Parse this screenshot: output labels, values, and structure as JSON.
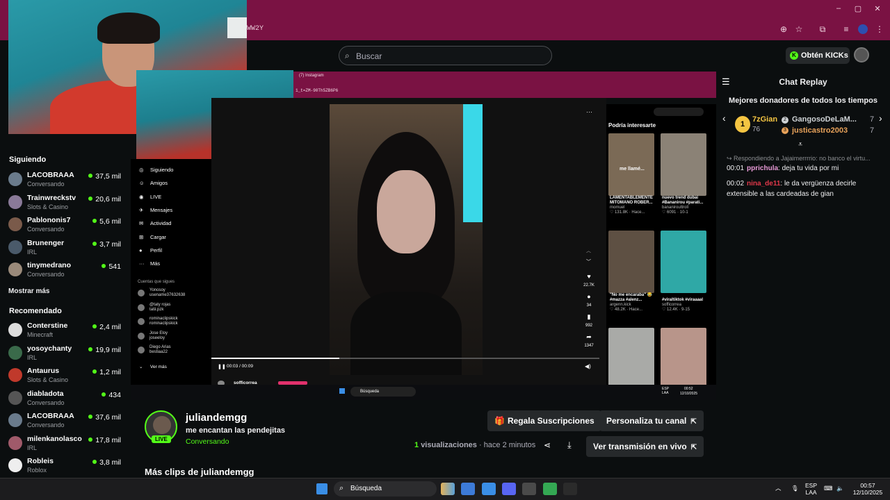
{
  "browser": {
    "url_fragment": "WW2Y",
    "window_controls": [
      "–",
      "▢",
      "✕"
    ]
  },
  "header": {
    "search_placeholder": "Buscar",
    "kicks_button": "Obtén KICKs"
  },
  "sidebar": {
    "following_title": "Siguiendo",
    "following": [
      {
        "name": "LACOBRAAA",
        "category": "Conversando",
        "viewers": "37,5 mil",
        "color": "#6a7b8c"
      },
      {
        "name": "Trainwreckstv",
        "category": "Slots & Casino",
        "viewers": "20,6 mil",
        "color": "#8a7a99"
      },
      {
        "name": "Pablononis7",
        "category": "Conversando",
        "viewers": "5,6 mil",
        "color": "#7a5a4a"
      },
      {
        "name": "Brunenger",
        "category": "IRL",
        "viewers": "3,7 mil",
        "color": "#4a5a6a"
      },
      {
        "name": "tinymedrano",
        "category": "Conversando",
        "viewers": "541",
        "color": "#9a8a7a"
      }
    ],
    "show_more": "Mostrar más",
    "recommended_title": "Recomendado",
    "recommended": [
      {
        "name": "Conterstine",
        "category": "Minecraft",
        "viewers": "2,4 mil",
        "color": "#ddd"
      },
      {
        "name": "yosoychanty",
        "category": "IRL",
        "viewers": "19,9 mil",
        "color": "#3a6a4a"
      },
      {
        "name": "Antaurus",
        "category": "Slots & Casino",
        "viewers": "1,2 mil",
        "color": "#c0392b"
      },
      {
        "name": "diabladota",
        "category": "Conversando",
        "viewers": "434",
        "color": "#555"
      },
      {
        "name": "LACOBRAAA",
        "category": "Conversando",
        "viewers": "37,6 mil",
        "color": "#6a7b8c"
      },
      {
        "name": "milenkanolasco",
        "category": "IRL",
        "viewers": "17,8 mil",
        "color": "#a05a6a"
      },
      {
        "name": "Robleis",
        "category": "Roblox",
        "viewers": "3,8 mil",
        "color": "#eee"
      }
    ]
  },
  "instagram": {
    "tab_title": "(7) Instagram",
    "url": "1_t=ZM-90Th5ZB6P6",
    "nav": [
      {
        "icon": "◎",
        "label": "Siguiendo"
      },
      {
        "icon": "☺",
        "label": "Amigos"
      },
      {
        "icon": "◉",
        "label": "LIVE"
      },
      {
        "icon": "✈",
        "label": "Mensajes"
      },
      {
        "icon": "✉",
        "label": "Actividad"
      },
      {
        "icon": "⊞",
        "label": "Cargar"
      },
      {
        "icon": "●",
        "label": "Perfil"
      },
      {
        "icon": "···",
        "label": "Más"
      }
    ],
    "followed_title": "Cuentas que sigues",
    "followed": [
      {
        "name": "Yonosoy",
        "handle": "usename37632638"
      },
      {
        "name": "@taty rojas",
        "handle": "tatii.pzk"
      },
      {
        "name": "rominaclipskick",
        "handle": "rominaclipskick"
      },
      {
        "name": "Jose Eloy",
        "handle": "joseeloy"
      },
      {
        "name": "Diego Arias",
        "handle": "bestiaa22"
      }
    ],
    "see_more": "Ver más",
    "time": "00:03 / 00:09",
    "progress": 0.33,
    "bottom_user": "sofficorrea",
    "actions": [
      {
        "icon": "♥",
        "count": "22.7K"
      },
      {
        "icon": "●",
        "count": "34"
      },
      {
        "icon": "▮",
        "count": "992"
      },
      {
        "icon": "➦",
        "count": "1347"
      }
    ],
    "suggestions_title": "Podría interesarte",
    "suggestions": [
      {
        "overlay": "me llamé...",
        "label": "LAMENTABLEMENTE MITOMANO ROBER...",
        "user": "momuel",
        "stats": "♡ 131.8K · Hace...",
        "color": "#7b6a56"
      },
      {
        "overlay": "",
        "label": "nuevo trend dubai #Bananirou #parati...",
        "user": "bananirouttroll",
        "stats": "♡ 6091 · 10-1",
        "color": "#8b8276"
      },
      {
        "overlay": "",
        "label": "\"No me encaraba\" 😂 #mazza #alenz...",
        "user": "argenn.kick",
        "stats": "♡ 48.2K · Hace...",
        "color": "#5e5043"
      },
      {
        "overlay": "",
        "label": "#viraltiktok #viraaaal",
        "user": "sofficorrea",
        "stats": "♡ 12.4K · 9-15",
        "color": "#2fa8a6"
      },
      {
        "overlay": "",
        "label": "",
        "user": "",
        "stats": "",
        "color": "#a9aaa7"
      },
      {
        "overlay": "",
        "label": "",
        "user": "",
        "stats": "",
        "color": "#b8958a"
      }
    ],
    "taskbar_search": "Búsqueda",
    "taskbar_lang": "ESP LAA",
    "taskbar_time": "00:52",
    "taskbar_date": "12/10/2025"
  },
  "chat": {
    "title": "Chat Replay",
    "donors_title": "Mejores donadores de todos los tiempos",
    "donors": [
      {
        "rank": "1",
        "name": "7zGian",
        "amount": "76",
        "color": "#f5c542"
      },
      {
        "rank": "2",
        "name": "GangosoDeLaM...",
        "amount": "7",
        "color": "#cfd3d6"
      },
      {
        "rank": "3",
        "name": "justicastro2003",
        "amount": "7",
        "color": "#e8a25a"
      }
    ],
    "reply_to": "Respondiendo a Jajaimerrrrio: no banco el virtu...",
    "messages": [
      {
        "time": "00:01",
        "user": "pprichula",
        "user_color": "#e99bd8",
        "text": "deja tu vida por mi"
      },
      {
        "time": "00:02",
        "user": "nina_de11",
        "user_color": "#e2384a",
        "text": "le da vergüenza decirle extensible a las cardeadas de gian"
      }
    ]
  },
  "clip": {
    "streamer": "juliandemgg",
    "title": "me encantan las pendejitas",
    "category": "Conversando",
    "live_badge": "LIVE",
    "gift_button": "Regala Suscripciones",
    "customize_button": "Personaliza tu canal",
    "views_count": "1",
    "views_label": "visualizaciones",
    "time_ago": "hace 2 minutos",
    "watch_live_button": "Ver transmisión en vivo",
    "more_clips": "Más clips de juliandemgg"
  },
  "taskbar": {
    "search": "Búsqueda",
    "lang_top": "ESP",
    "lang_bottom": "LAA",
    "time": "00:57",
    "date": "12/10/2025",
    "apps": [
      {
        "name": "task-view",
        "color": "#c8c8c8"
      },
      {
        "name": "copilot",
        "color": "#3d7bd8"
      },
      {
        "name": "photos",
        "color": "#3a8ee6"
      },
      {
        "name": "discord",
        "color": "#5865f2"
      },
      {
        "name": "calculator",
        "color": "#4a4a4a"
      },
      {
        "name": "chrome",
        "color": "#34a853"
      },
      {
        "name": "obs",
        "color": "#2b2b2b"
      }
    ]
  }
}
